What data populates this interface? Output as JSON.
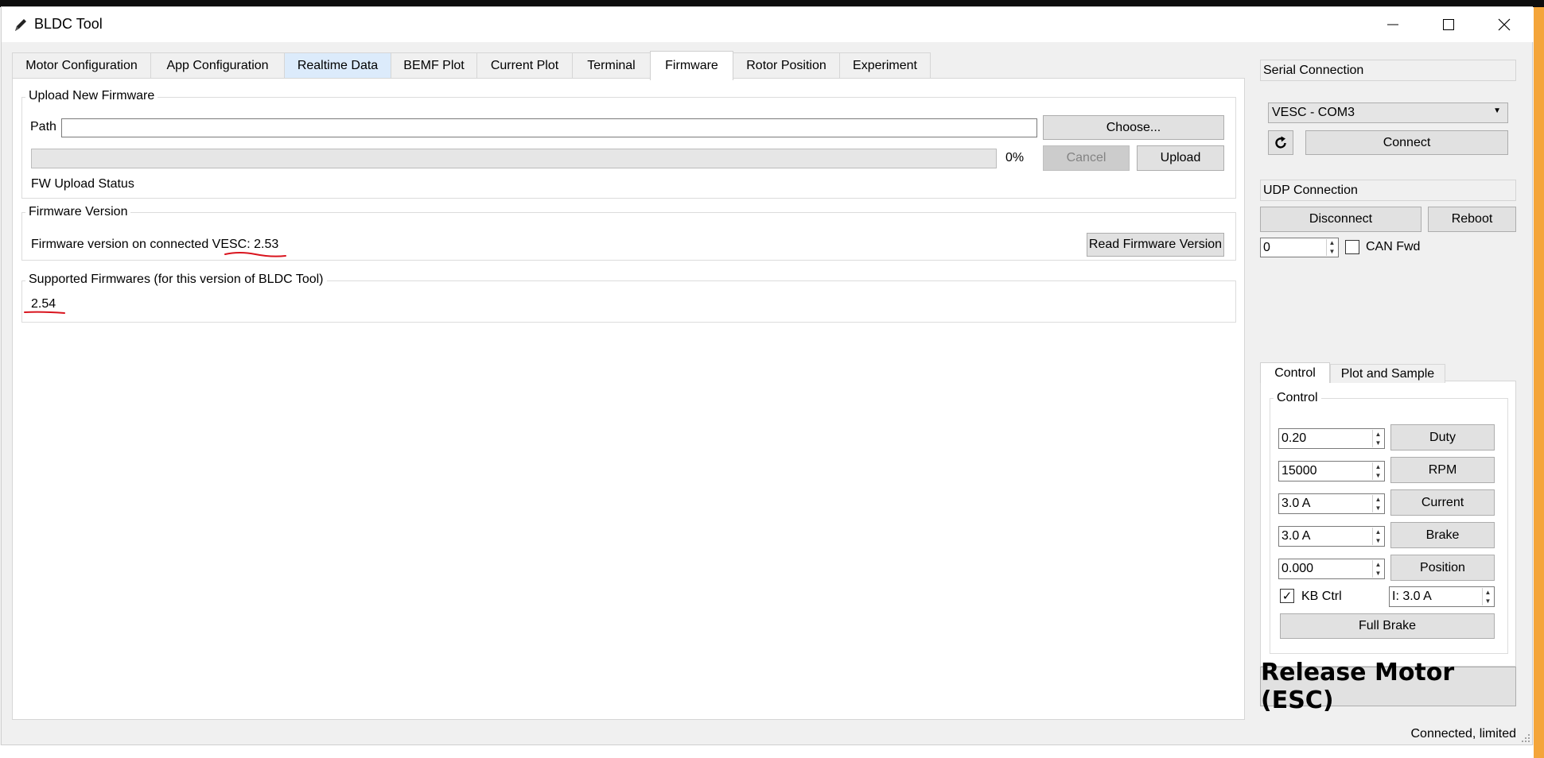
{
  "window": {
    "title": "BLDC Tool",
    "status": "Connected, limited"
  },
  "tabs": [
    {
      "label": "Motor Configuration"
    },
    {
      "label": "App Configuration"
    },
    {
      "label": "Realtime Data"
    },
    {
      "label": "BEMF Plot"
    },
    {
      "label": "Current Plot"
    },
    {
      "label": "Terminal"
    },
    {
      "label": "Firmware"
    },
    {
      "label": "Rotor Position"
    },
    {
      "label": "Experiment"
    }
  ],
  "active_tab": "Firmware",
  "upload": {
    "group_title": "Upload New Firmware",
    "path_label": "Path",
    "path_value": "",
    "choose_label": "Choose...",
    "progress_percent": 0,
    "progress_text": "0%",
    "cancel_label": "Cancel",
    "upload_label": "Upload",
    "status": "FW Upload Status"
  },
  "firmware_version": {
    "group_title": "Firmware Version",
    "text": "Firmware version on connected VESC: 2.53",
    "read_label": "Read Firmware Version"
  },
  "supported": {
    "group_title": "Supported Firmwares (for this version of BLDC Tool)",
    "versions": "2.54"
  },
  "serial": {
    "header": "Serial Connection",
    "port": "VESC - COM3",
    "connect_label": "Connect"
  },
  "udp": {
    "header": "UDP Connection",
    "disconnect_label": "Disconnect",
    "reboot_label": "Reboot",
    "can_id": "0",
    "can_fwd_label": "CAN Fwd",
    "can_fwd_checked": false
  },
  "control_tabs": [
    {
      "label": "Control"
    },
    {
      "label": "Plot and Sample"
    }
  ],
  "control": {
    "group_title": "Control",
    "rows": [
      {
        "value": "0.20",
        "button": "Duty"
      },
      {
        "value": "15000",
        "button": "RPM"
      },
      {
        "value": "3.0 A",
        "button": "Current"
      },
      {
        "value": "3.0 A",
        "button": "Brake"
      },
      {
        "value": "0.000",
        "button": "Position"
      }
    ],
    "kb_ctrl_label": "KB Ctrl",
    "kb_ctrl_checked": true,
    "kb_current": "I: 3.0 A",
    "full_brake_label": "Full Brake"
  },
  "release_label": "Release Motor (ESC)",
  "colors": {
    "annotation": "#d9141e",
    "tab_hover": "#dcebfb",
    "background_accent": "#f4a53a"
  }
}
